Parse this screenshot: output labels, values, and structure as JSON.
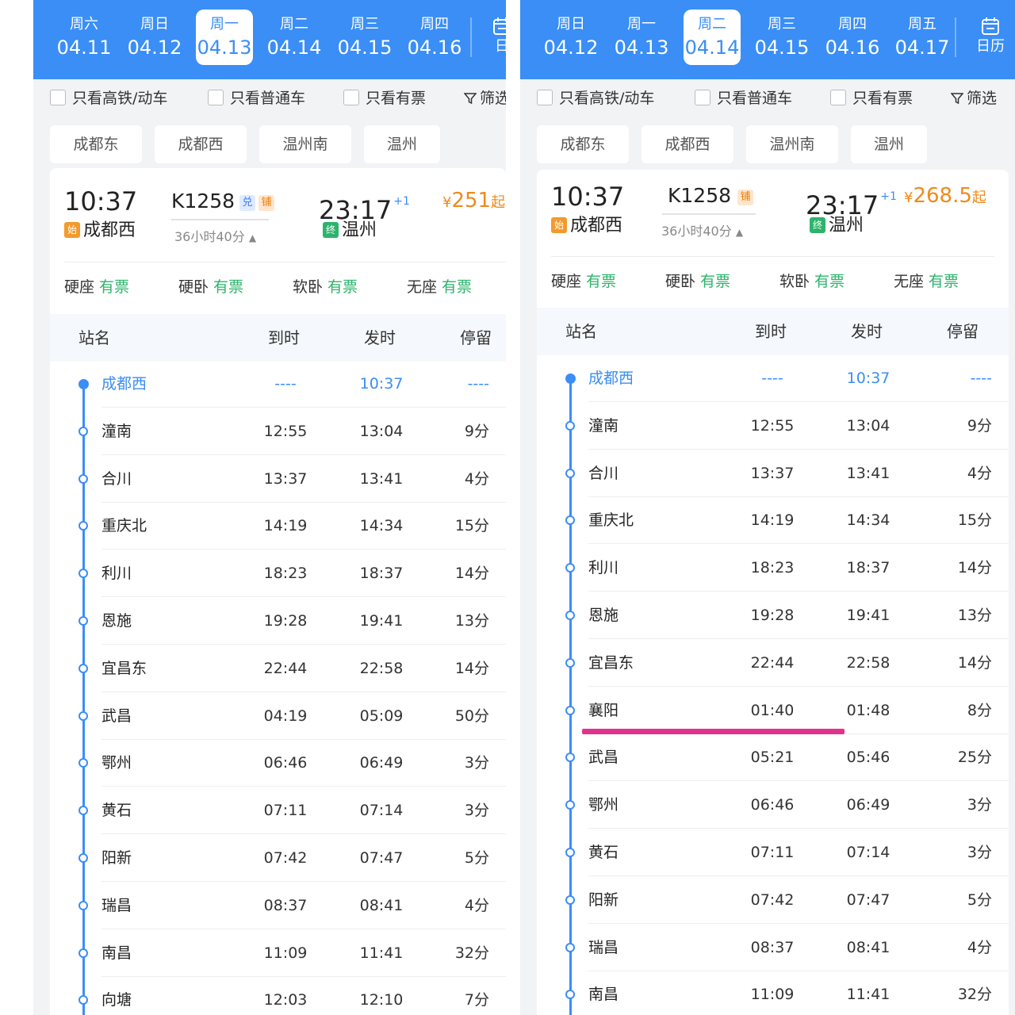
{
  "left": {
    "tabs": [
      {
        "weekday": "周六",
        "date": "04.11"
      },
      {
        "weekday": "周日",
        "date": "04.12"
      },
      {
        "weekday": "周一",
        "date": "04.13",
        "active": true
      },
      {
        "weekday": "周二",
        "date": "04.14"
      },
      {
        "weekday": "周三",
        "date": "04.15"
      },
      {
        "weekday": "周四",
        "date": "04.16"
      }
    ],
    "calendar_label": "日",
    "filters": [
      "只看高铁/动车",
      "只看普通车",
      "只看有票",
      "筛选"
    ],
    "stations": [
      "成都东",
      "成都西",
      "温州南",
      "温州"
    ],
    "train": {
      "dep_time": "10:37",
      "dep_station": "成都西",
      "start_badge": "始",
      "train_no": "K1258",
      "tag1": "兑",
      "tag2": "铺",
      "duration": "36小时40分",
      "arr_time": "23:17",
      "day_offset": "+1",
      "arr_station": "温州",
      "end_badge": "终",
      "price_symbol": "¥",
      "price": "251",
      "price_suffix": "起"
    },
    "seats": [
      {
        "type": "硬座",
        "status": "有票"
      },
      {
        "type": "硬卧",
        "status": "有票"
      },
      {
        "type": "软卧",
        "status": "有票"
      },
      {
        "type": "无座",
        "status": "有票"
      }
    ],
    "headers": {
      "name": "站名",
      "arrive": "到时",
      "depart": "发时",
      "stop": "停留"
    },
    "rows": [
      {
        "name": "成都西",
        "arrive": "----",
        "depart": "10:37",
        "stop": "----"
      },
      {
        "name": "潼南",
        "arrive": "12:55",
        "depart": "13:04",
        "stop": "9分"
      },
      {
        "name": "合川",
        "arrive": "13:37",
        "depart": "13:41",
        "stop": "4分"
      },
      {
        "name": "重庆北",
        "arrive": "14:19",
        "depart": "14:34",
        "stop": "15分"
      },
      {
        "name": "利川",
        "arrive": "18:23",
        "depart": "18:37",
        "stop": "14分"
      },
      {
        "name": "恩施",
        "arrive": "19:28",
        "depart": "19:41",
        "stop": "13分"
      },
      {
        "name": "宜昌东",
        "arrive": "22:44",
        "depart": "22:58",
        "stop": "14分"
      },
      {
        "name": "武昌",
        "arrive": "04:19",
        "depart": "05:09",
        "stop": "50分"
      },
      {
        "name": "鄂州",
        "arrive": "06:46",
        "depart": "06:49",
        "stop": "3分"
      },
      {
        "name": "黄石",
        "arrive": "07:11",
        "depart": "07:14",
        "stop": "3分"
      },
      {
        "name": "阳新",
        "arrive": "07:42",
        "depart": "07:47",
        "stop": "5分"
      },
      {
        "name": "瑞昌",
        "arrive": "08:37",
        "depart": "08:41",
        "stop": "4分"
      },
      {
        "name": "南昌",
        "arrive": "11:09",
        "depart": "11:41",
        "stop": "32分"
      },
      {
        "name": "向塘",
        "arrive": "12:03",
        "depart": "12:10",
        "stop": "7分"
      }
    ]
  },
  "right": {
    "tabs": [
      {
        "weekday": "周日",
        "date": "04.12"
      },
      {
        "weekday": "周一",
        "date": "04.13"
      },
      {
        "weekday": "周二",
        "date": "04.14",
        "active": true
      },
      {
        "weekday": "周三",
        "date": "04.15"
      },
      {
        "weekday": "周四",
        "date": "04.16"
      },
      {
        "weekday": "周五",
        "date": "04.17"
      }
    ],
    "calendar_label": "日历",
    "filters": [
      "只看高铁/动车",
      "只看普通车",
      "只看有票",
      "筛选"
    ],
    "stations": [
      "成都东",
      "成都西",
      "温州南",
      "温州"
    ],
    "train": {
      "dep_time": "10:37",
      "dep_station": "成都西",
      "start_badge": "始",
      "train_no": "K1258",
      "tag1": "铺",
      "duration": "36小时40分",
      "arr_time": "23:17",
      "day_offset": "+1",
      "arr_station": "温州",
      "end_badge": "终",
      "price_symbol": "¥",
      "price": "268.5",
      "price_suffix": "起"
    },
    "seats": [
      {
        "type": "硬座",
        "status": "有票"
      },
      {
        "type": "硬卧",
        "status": "有票"
      },
      {
        "type": "软卧",
        "status": "有票"
      },
      {
        "type": "无座",
        "status": "有票"
      }
    ],
    "headers": {
      "name": "站名",
      "arrive": "到时",
      "depart": "发时",
      "stop": "停留"
    },
    "rows": [
      {
        "name": "成都西",
        "arrive": "----",
        "depart": "10:37",
        "stop": "----"
      },
      {
        "name": "潼南",
        "arrive": "12:55",
        "depart": "13:04",
        "stop": "9分"
      },
      {
        "name": "合川",
        "arrive": "13:37",
        "depart": "13:41",
        "stop": "4分"
      },
      {
        "name": "重庆北",
        "arrive": "14:19",
        "depart": "14:34",
        "stop": "15分"
      },
      {
        "name": "利川",
        "arrive": "18:23",
        "depart": "18:37",
        "stop": "14分"
      },
      {
        "name": "恩施",
        "arrive": "19:28",
        "depart": "19:41",
        "stop": "13分"
      },
      {
        "name": "宜昌东",
        "arrive": "22:44",
        "depart": "22:58",
        "stop": "14分"
      },
      {
        "name": "襄阳",
        "arrive": "01:40",
        "depart": "01:48",
        "stop": "8分"
      },
      {
        "name": "武昌",
        "arrive": "05:21",
        "depart": "05:46",
        "stop": "25分"
      },
      {
        "name": "鄂州",
        "arrive": "06:46",
        "depart": "06:49",
        "stop": "3分"
      },
      {
        "name": "黄石",
        "arrive": "07:11",
        "depart": "07:14",
        "stop": "3分"
      },
      {
        "name": "阳新",
        "arrive": "07:42",
        "depart": "07:47",
        "stop": "5分"
      },
      {
        "name": "瑞昌",
        "arrive": "08:37",
        "depart": "08:41",
        "stop": "4分"
      },
      {
        "name": "南昌",
        "arrive": "11:09",
        "depart": "11:41",
        "stop": "32分"
      }
    ]
  },
  "colors": {
    "accent": "#3a8ef6",
    "price": "#f08a1c",
    "available": "#2db36b",
    "highlight": "#e0338e"
  }
}
